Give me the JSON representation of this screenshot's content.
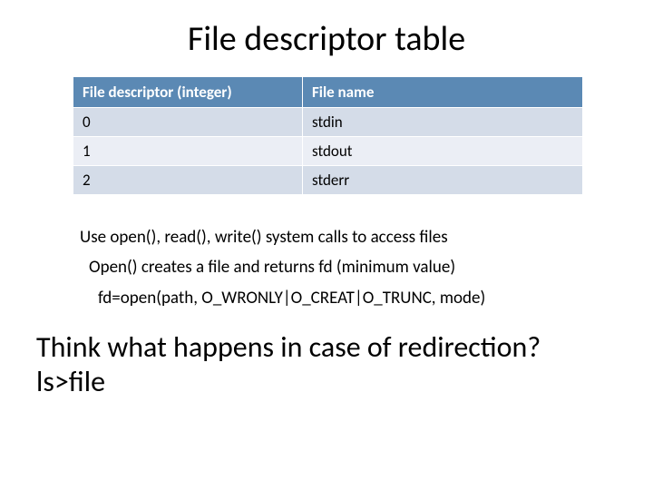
{
  "title": "File descriptor table",
  "table": {
    "headers": [
      "File descriptor (integer)",
      "File name"
    ],
    "rows": [
      {
        "fd": "0",
        "name": "stdin"
      },
      {
        "fd": "1",
        "name": "stdout"
      },
      {
        "fd": "2",
        "name": "stderr"
      }
    ]
  },
  "bullets": {
    "line1": "Use open(), read(), write() system calls to access files",
    "line2": "Open() creates a file and returns fd (minimum value)",
    "line3": "fd=open(path, O_WRONLY|O_CREAT|O_TRUNC, mode)"
  },
  "question": {
    "line1": "Think what happens in case of redirection?",
    "line2": "ls>file"
  }
}
